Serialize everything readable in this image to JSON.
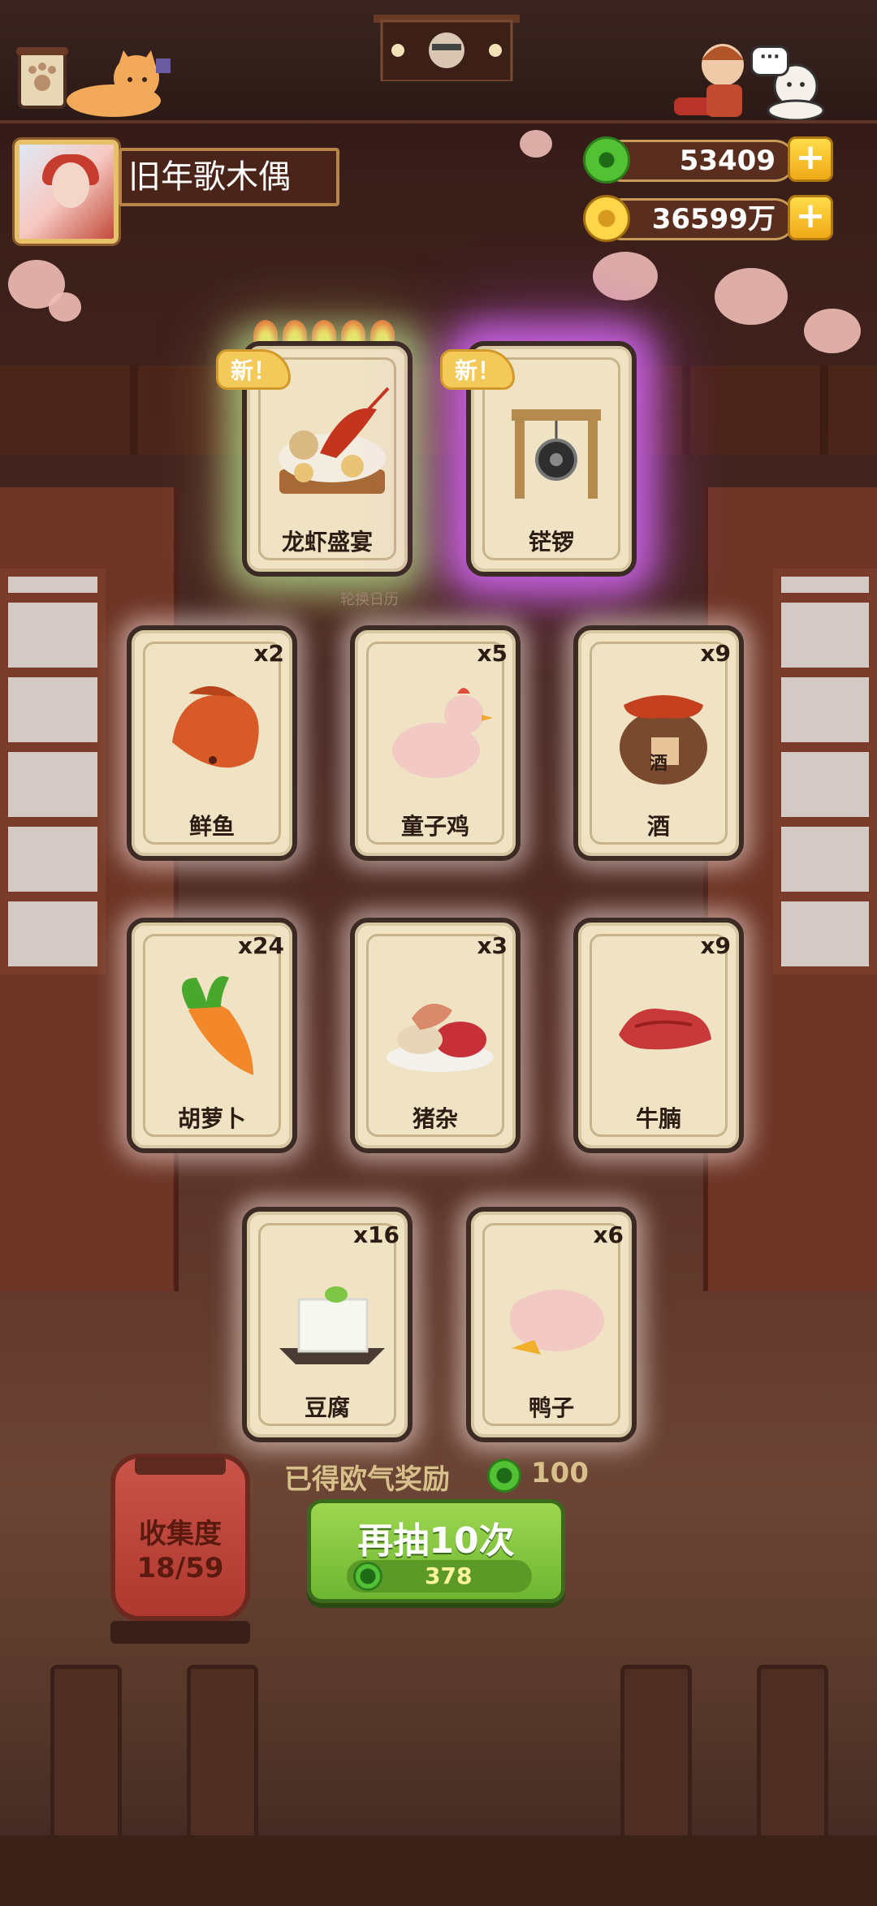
{
  "player": {
    "name": "旧年歌木偶"
  },
  "currency": {
    "jade": "53409",
    "coins": "36599万"
  },
  "featured_cards": [
    {
      "label": "龙虾盛宴",
      "tag": "新！",
      "flames": 5
    },
    {
      "label": "铓锣",
      "tag": "新！"
    }
  ],
  "calendar_hint": "轮换日历",
  "cards": [
    {
      "label": "鲜鱼",
      "count": "x2"
    },
    {
      "label": "童子鸡",
      "count": "x5"
    },
    {
      "label": "酒",
      "count": "x9"
    },
    {
      "label": "胡萝卜",
      "count": "x24"
    },
    {
      "label": "猪杂",
      "count": "x3"
    },
    {
      "label": "牛腩",
      "count": "x9"
    },
    {
      "label": "豆腐",
      "count": "x16"
    },
    {
      "label": "鸭子",
      "count": "x6"
    }
  ],
  "reward": {
    "text": "已得欧气奖励",
    "amount": "100"
  },
  "collection": {
    "label": "收集度",
    "progress": "18/59"
  },
  "draw_button": {
    "label": "再抽10次",
    "cost": "378"
  },
  "chat_bubble": "···",
  "wine_glyph": "酒",
  "plus_symbol": "+"
}
